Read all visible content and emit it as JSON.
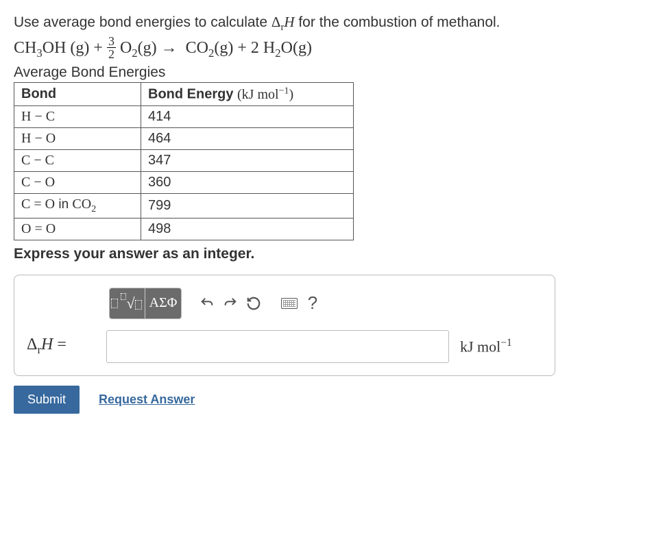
{
  "prompt": {
    "text_before": "Use average bond energies to calculate ",
    "delta_symbol": "Δ",
    "subscript": "r",
    "var": "H",
    "text_after": " for the combustion of methanol."
  },
  "equation": {
    "reactant1": "CH",
    "r1_sub": "3",
    "r1_tail": "OH",
    "phase1": "(g)",
    "plus": "+",
    "frac_num": "3",
    "frac_den": "2",
    "reactant2": "O",
    "r2_sub": "2",
    "phase2": "(g)",
    "arrow": "→",
    "product1": "CO",
    "p1_sub": "2",
    "phase3": "(g)",
    "plus2": "+",
    "coeff2": "2",
    "product2_a": "H",
    "p2_sub": "2",
    "product2_b": "O",
    "phase4": "(g)"
  },
  "subheading": "Average Bond Energies",
  "table": {
    "header_bond": "Bond",
    "header_energy_prefix": "Bond Energy",
    "header_energy_unit_open": "(kJ mol",
    "header_energy_exp": "−1",
    "header_energy_unit_close": ")",
    "rows": [
      {
        "bond": "H − C",
        "energy": "414"
      },
      {
        "bond": "H − O",
        "energy": "464"
      },
      {
        "bond": "C − C",
        "energy": "347"
      },
      {
        "bond": "C − O",
        "energy": "360"
      },
      {
        "bond_prefix": "C = O",
        "bond_note": " in ",
        "bond_suffix": "CO",
        "bond_sub": "2",
        "energy": "799"
      },
      {
        "bond": "O = O",
        "energy": "498"
      }
    ]
  },
  "instruction": "Express your answer as an integer.",
  "toolbar": {
    "template_btn": "template",
    "greek_label": "ΑΣΦ",
    "undo": "↶",
    "redo": "↷",
    "reset": "↻",
    "keyboard": "keyboard",
    "help": "?"
  },
  "answer": {
    "lhs_delta": "Δ",
    "lhs_sub": "r",
    "lhs_var": "H",
    "lhs_eq": " =",
    "value": "",
    "unit_prefix": "kJ mol",
    "unit_exp": "−1"
  },
  "buttons": {
    "submit": "Submit",
    "request": "Request Answer"
  }
}
